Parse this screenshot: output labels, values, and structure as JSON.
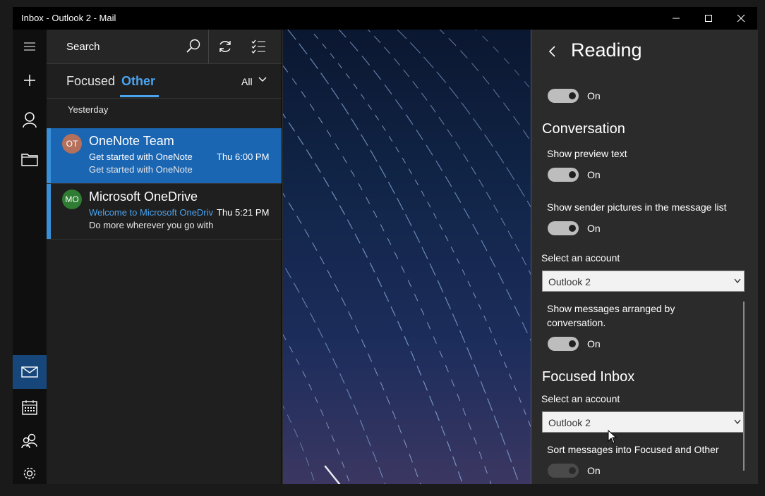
{
  "window": {
    "title": "Inbox - Outlook 2 - Mail"
  },
  "search": {
    "placeholder": "Search"
  },
  "tabs": {
    "focused": "Focused",
    "other": "Other",
    "filter": "All"
  },
  "list": {
    "group": "Yesterday",
    "items": [
      {
        "initials": "OT",
        "sender": "OneNote Team",
        "subject": "Get started with OneNote",
        "time": "Thu 6:00 PM",
        "preview": "Get started  with OneNote",
        "avatar_color": "#b5705b",
        "selected": true
      },
      {
        "initials": "MO",
        "sender": "Microsoft OneDrive",
        "subject": "Welcome to Microsoft OneDrive",
        "time": "Thu 5:21 PM",
        "preview": "Do more wherever you go with",
        "avatar_color": "#2e7d32",
        "selected": false
      }
    ]
  },
  "settings": {
    "title": "Reading",
    "top_toggle_state": "On",
    "conversation": {
      "title": "Conversation",
      "preview_label": "Show preview text",
      "preview_state": "On",
      "pictures_label": "Show sender pictures in the message list",
      "pictures_state": "On",
      "account_label": "Select an account",
      "account_value": "Outlook 2",
      "arranged_label": "Show messages arranged by conversation.",
      "arranged_state": "On"
    },
    "focused_inbox": {
      "title": "Focused Inbox",
      "account_label": "Select an account",
      "account_value": "Outlook 2",
      "sort_label": "Sort messages into Focused and Other",
      "sort_state": "On"
    }
  },
  "colors": {
    "accent": "#4aa3ee",
    "selected": "#1a66b3",
    "rail_active": "#17477a"
  }
}
